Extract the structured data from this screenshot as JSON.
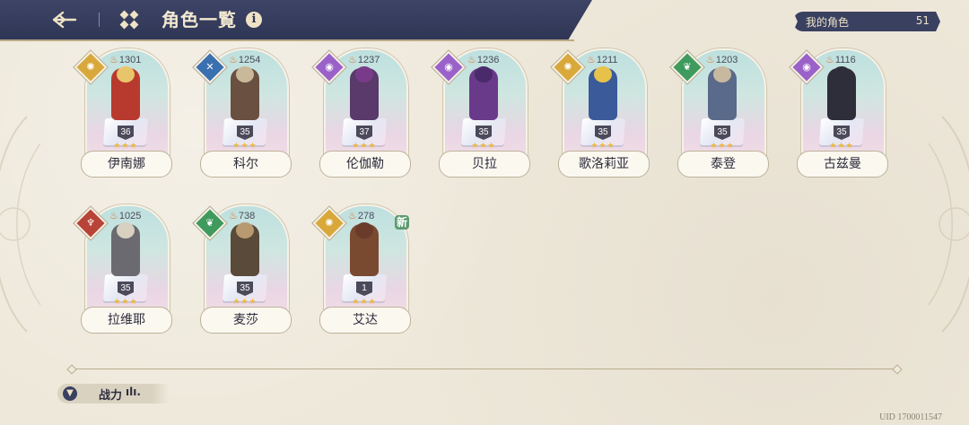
{
  "header": {
    "title": "角色一覧",
    "info_label": "i"
  },
  "my_characters": {
    "label": "我的角色",
    "count": "51"
  },
  "characters": [
    {
      "name": "伊南娜",
      "power": "1301",
      "level": "36",
      "element": "light",
      "elem_color": "#d8a83a",
      "sprite_color": "#b83a2e",
      "hair_color": "#e8c56a"
    },
    {
      "name": "科尔",
      "power": "1254",
      "level": "35",
      "element": "blade",
      "elem_color": "#3a6fb0",
      "sprite_color": "#6a5040",
      "hair_color": "#c9b89a"
    },
    {
      "name": "伦伽勒",
      "power": "1237",
      "level": "37",
      "element": "arcane",
      "elem_color": "#9a62c8",
      "sprite_color": "#5a3a6a",
      "hair_color": "#7a3a8a"
    },
    {
      "name": "贝拉",
      "power": "1236",
      "level": "35",
      "element": "arcane",
      "elem_color": "#9a62c8",
      "sprite_color": "#6a3a8a",
      "hair_color": "#4a2a6a"
    },
    {
      "name": "歌洛莉亚",
      "power": "1211",
      "level": "35",
      "element": "light",
      "elem_color": "#d8a83a",
      "sprite_color": "#3a5a9a",
      "hair_color": "#e6c24a"
    },
    {
      "name": "泰登",
      "power": "1203",
      "level": "35",
      "element": "nature",
      "elem_color": "#3f9a5e",
      "sprite_color": "#5a6a8a",
      "hair_color": "#c8b8a0"
    },
    {
      "name": "古兹曼",
      "power": "1116",
      "level": "35",
      "element": "arcane",
      "elem_color": "#9a62c8",
      "sprite_color": "#2e2e3a",
      "hair_color": "#2e2e3a"
    },
    {
      "name": "拉维耶",
      "power": "1025",
      "level": "35",
      "element": "fire",
      "elem_color": "#b84438",
      "sprite_color": "#6a6a70",
      "hair_color": "#d8d0c0"
    },
    {
      "name": "麦莎",
      "power": "738",
      "level": "35",
      "element": "nature",
      "elem_color": "#3f9a5e",
      "sprite_color": "#5a4a3a",
      "hair_color": "#b89a70"
    },
    {
      "name": "艾达",
      "power": "278",
      "level": "1",
      "element": "light",
      "elem_color": "#d8a83a",
      "sprite_color": "#7a4a30",
      "hair_color": "#6a3a2a",
      "is_new": true,
      "new_label": "新"
    }
  ],
  "sort": {
    "label": "战力",
    "icon": "filter-icon"
  },
  "uid": "UID 1700011547"
}
